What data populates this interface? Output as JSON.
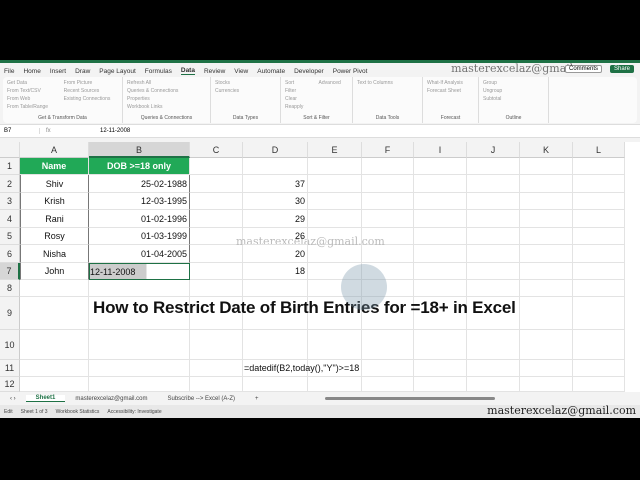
{
  "ribbon_tabs": [
    "File",
    "Home",
    "Insert",
    "Draw",
    "Page Layout",
    "Formulas",
    "Data",
    "Review",
    "View",
    "Automate",
    "Developer",
    "Power Pivot"
  ],
  "active_tab": "Data",
  "comments_label": "Comments",
  "share_label": "Share",
  "watermark": "masterexcelaz@gmail.com",
  "groups": [
    {
      "label": "Get & Transform Data",
      "items": [
        "Get Data",
        "From Text/CSV",
        "From Web",
        "From Table/Range",
        "From Picture",
        "Recent Sources",
        "Existing Connections"
      ]
    },
    {
      "label": "Queries & Connections",
      "items": [
        "Refresh All",
        "Queries & Connections",
        "Properties",
        "Workbook Links"
      ]
    },
    {
      "label": "Data Types",
      "items": [
        "Stocks",
        "Currencies"
      ]
    },
    {
      "label": "Sort & Filter",
      "items": [
        "Sort",
        "Filter",
        "Clear",
        "Reapply",
        "Advanced"
      ]
    },
    {
      "label": "Data Tools",
      "items": [
        "Text to Columns"
      ]
    },
    {
      "label": "Forecast",
      "items": [
        "What-If Analysis",
        "Forecast Sheet"
      ]
    },
    {
      "label": "Outline",
      "items": [
        "Group",
        "Ungroup",
        "Subtotal"
      ]
    }
  ],
  "formula_bar": {
    "name_box": "B7",
    "fx": "fx",
    "value": "12-11-2008"
  },
  "columns": [
    "A",
    "B",
    "C",
    "D",
    "E",
    "F",
    "I",
    "J",
    "K",
    "L"
  ],
  "rows": [
    "1",
    "2",
    "3",
    "4",
    "5",
    "6",
    "7",
    "8",
    "9",
    "10",
    "11",
    "12"
  ],
  "table": {
    "headers": [
      "Name",
      "DOB >=18 only"
    ],
    "rows": [
      [
        "Shiv",
        "25-02-1988",
        "37"
      ],
      [
        "Krish",
        "12-03-1995",
        "30"
      ],
      [
        "Rani",
        "01-02-1996",
        "29"
      ],
      [
        "Rosy",
        "01-03-1999",
        "26"
      ],
      [
        "Nisha",
        "01-04-2005",
        "20"
      ],
      [
        "John",
        "12-11-2008",
        "18"
      ]
    ]
  },
  "title": "How to Restrict Date of Birth Entries for =18+ in Excel",
  "formula_text": "=datedif(B2,today(),\"Y\")>=18",
  "sheet_tabs": [
    "Sheet1",
    "masterexcelaz@gmail.com",
    "Subscribe --> Excel (A-Z)"
  ],
  "add_sheet": "+",
  "status": [
    "Edit",
    "Sheet 1 of 3",
    "Workbook Statistics",
    "Accessibility: Investigate"
  ]
}
